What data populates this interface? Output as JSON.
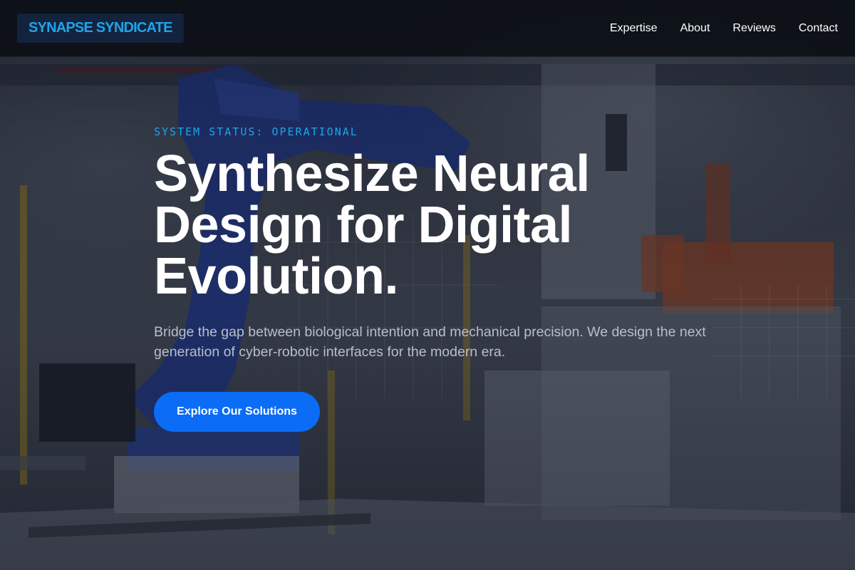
{
  "header": {
    "logo_text": "SYNAPSE SYNDICATE",
    "nav": [
      {
        "label": "Expertise"
      },
      {
        "label": "About"
      },
      {
        "label": "Reviews"
      },
      {
        "label": "Contact"
      }
    ]
  },
  "hero": {
    "status": "SYSTEM STATUS: OPERATIONAL",
    "title": "Synthesize Neural Design for Digital Evolution.",
    "description": "Bridge the gap between biological intention and mechanical precision. We design the next generation of cyber-robotic interfaces for the modern era.",
    "cta_label": "Explore Our Solutions",
    "background_image": "factory robotic arm"
  },
  "colors": {
    "accent": "#1fa4e8",
    "button": "#0b6cf5",
    "header_bg": "#0c0f16",
    "logo_bg": "#13233d"
  }
}
